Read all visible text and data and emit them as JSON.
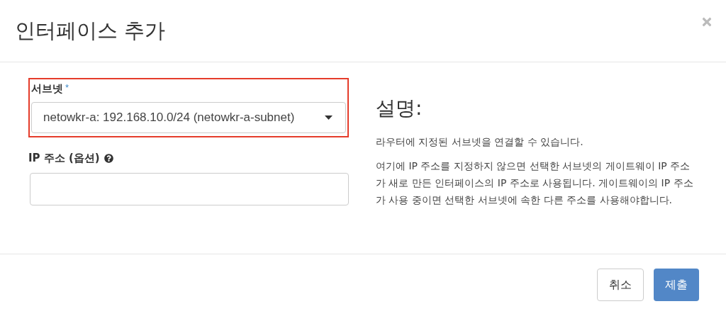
{
  "dialog": {
    "title": "인터페이스 추가"
  },
  "form": {
    "subnet": {
      "label": "서브넷",
      "required_mark": "*",
      "value": "netowkr-a: 192.168.10.0/24 (netowkr-a-subnet)",
      "highlighted": true
    },
    "ip_address": {
      "label": "IP 주소 (옵션)"
    }
  },
  "description": {
    "heading": "설명:",
    "paragraphs": [
      "라우터에 지정된 서브넷을 연결할 수 있습니다.",
      "여기에 IP 주소를 지정하지 않으면 선택한 서브넷의 게이트웨이 IP 주소가 새로 만든 인터페이스의 IP 주소로 사용됩니다. 게이트웨이의 IP 주소가 사용 중이면 선택한 서브넷에 속한 다른 주소를 사용해야합니다."
    ]
  },
  "buttons": [
    {
      "label": "취소",
      "kind": "default"
    },
    {
      "label": "제출",
      "kind": "primary"
    }
  ]
}
